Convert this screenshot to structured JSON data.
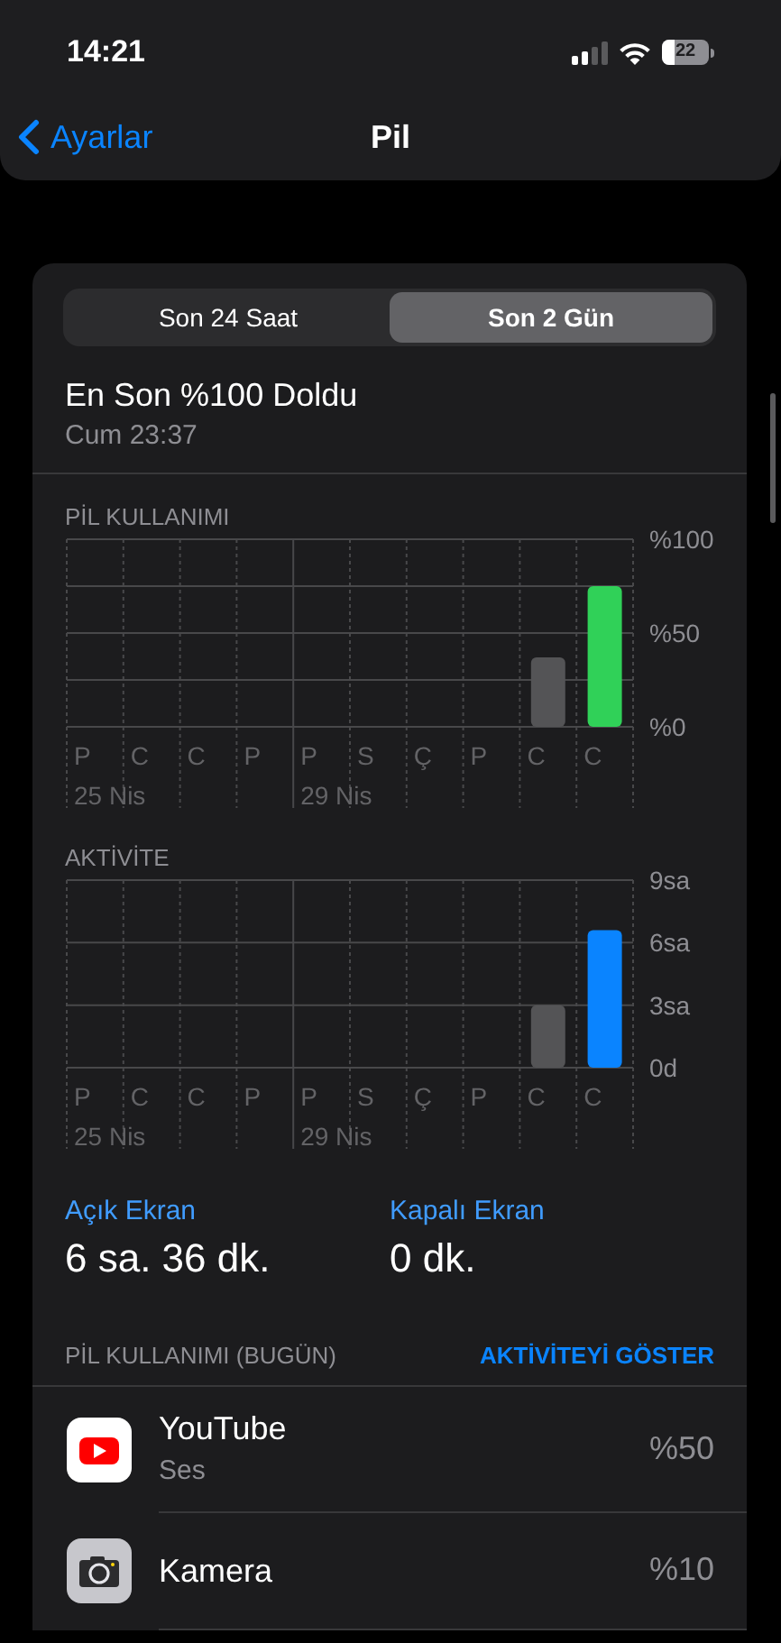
{
  "status_bar": {
    "time": "14:21",
    "battery": "22"
  },
  "nav": {
    "back": "Ayarlar",
    "title": "Pil"
  },
  "segments": [
    {
      "label": "Son 24 Saat",
      "selected": false
    },
    {
      "label": "Son 2 Gün",
      "selected": true
    }
  ],
  "last_charge": {
    "title": "En Son %100 Doldu",
    "time": "Cum 23:37"
  },
  "charts": [
    {
      "heading": "PİL KULLANIMI",
      "date_labels": [
        "25 Nis",
        "29 Nis"
      ],
      "chart_data": {
        "type": "bar",
        "categories": [
          "P",
          "C",
          "C",
          "P",
          "P",
          "S",
          "Ç",
          "P",
          "C",
          "C"
        ],
        "ylim": [
          0,
          100
        ],
        "yticks": [
          {
            "value": 0,
            "label": "%0"
          },
          {
            "value": 50,
            "label": "%50"
          },
          {
            "value": 100,
            "label": "%100"
          }
        ],
        "series": [
          {
            "color": "#545456",
            "values": [
              null,
              null,
              null,
              null,
              null,
              null,
              null,
              null,
              37,
              null
            ]
          },
          {
            "color": "#30d158",
            "values": [
              null,
              null,
              null,
              null,
              null,
              null,
              null,
              null,
              null,
              75
            ]
          }
        ]
      }
    },
    {
      "heading": "AKTİVİTE",
      "date_labels": [
        "25 Nis",
        "29 Nis"
      ],
      "chart_data": {
        "type": "bar",
        "categories": [
          "P",
          "C",
          "C",
          "P",
          "P",
          "S",
          "Ç",
          "P",
          "C",
          "C"
        ],
        "ylim": [
          0,
          9
        ],
        "yticks": [
          {
            "value": 0,
            "label": "0d"
          },
          {
            "value": 3,
            "label": "3sa"
          },
          {
            "value": 6,
            "label": "6sa"
          },
          {
            "value": 9,
            "label": "9sa"
          }
        ],
        "series": [
          {
            "color": "#545456",
            "values": [
              null,
              null,
              null,
              null,
              null,
              null,
              null,
              null,
              3,
              null
            ]
          },
          {
            "color": "#0a84ff",
            "values": [
              null,
              null,
              null,
              null,
              null,
              null,
              null,
              null,
              null,
              6.6
            ]
          }
        ]
      }
    }
  ],
  "screen_stats": [
    {
      "label": "Açık Ekran",
      "value": "6 sa. 36 dk."
    },
    {
      "label": "Kapalı Ekran",
      "value": "0 dk."
    }
  ],
  "usage_header": {
    "title": "PİL KULLANIMI (BUGÜN)",
    "action": "AKTİVİTEYİ GÖSTER"
  },
  "apps": [
    {
      "kind": "video",
      "name": "YouTube",
      "detail": "Ses",
      "percent": "%50"
    },
    {
      "kind": "camera",
      "name": "Kamera",
      "percent": "%10"
    }
  ]
}
